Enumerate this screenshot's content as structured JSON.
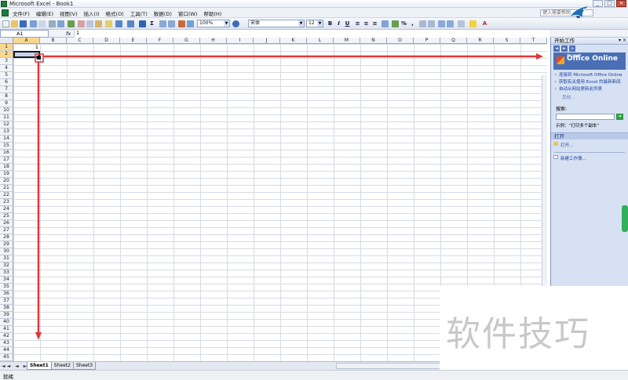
{
  "window": {
    "title": "Microsoft Excel - Book1",
    "controls": [
      "_",
      "□",
      "×"
    ]
  },
  "menu": {
    "items": [
      "文件(F)",
      "编辑(E)",
      "视图(V)",
      "插入(I)",
      "格式(O)",
      "工具(T)",
      "数据(D)",
      "窗口(W)",
      "帮助(H)"
    ],
    "help_placeholder": "键入需要帮助"
  },
  "toolbar": {
    "zoom": "100%",
    "font": "宋体",
    "size": "12"
  },
  "formula_bar": {
    "name_box": "A1",
    "fx": "fx",
    "content": "1"
  },
  "grid": {
    "columns": [
      "A",
      "B",
      "C",
      "D",
      "E",
      "F",
      "G",
      "H",
      "I",
      "J",
      "K",
      "L",
      "M",
      "N",
      "O",
      "P",
      "Q",
      "R",
      "S",
      "T"
    ],
    "rows": [
      "1",
      "2",
      "3",
      "4",
      "5",
      "6",
      "7",
      "8",
      "9",
      "10",
      "11",
      "12",
      "13",
      "14",
      "15",
      "16",
      "17",
      "18",
      "19",
      "20",
      "21",
      "22",
      "23",
      "24",
      "25",
      "26",
      "27",
      "28",
      "29",
      "30",
      "31",
      "32",
      "33",
      "34",
      "35",
      "36",
      "37",
      "38",
      "39",
      "40",
      "41",
      "42",
      "43",
      "44",
      "45"
    ],
    "a1_value": "1"
  },
  "sheets": {
    "tabs": [
      "Sheet1",
      "Sheet2",
      "Sheet3"
    ],
    "active": "Sheet1",
    "nav": "◄◄ ◄ ► ►►"
  },
  "status": {
    "text": "就绪"
  },
  "task_pane": {
    "title": "开始工作",
    "logo_text": "Office Online",
    "logo_sup": "Microsoft",
    "links": [
      "连接到 Microsoft Office Online",
      "获取有关使用 Excel 的最新新闻",
      "自动从网站更新此列表"
    ],
    "more": "其他...",
    "search_label": "搜索:",
    "example": "示例：“打印多个副本”",
    "open_section": "打开",
    "open_item": "打开...",
    "new_item": "新建工作簿..."
  },
  "watermark": {
    "text": "软件技巧"
  },
  "colors": {
    "arrow": "#d93a3a",
    "selection": "#c5d3ee",
    "header_selected": "#f9d88e",
    "task_pane": "#d6e1f4"
  }
}
